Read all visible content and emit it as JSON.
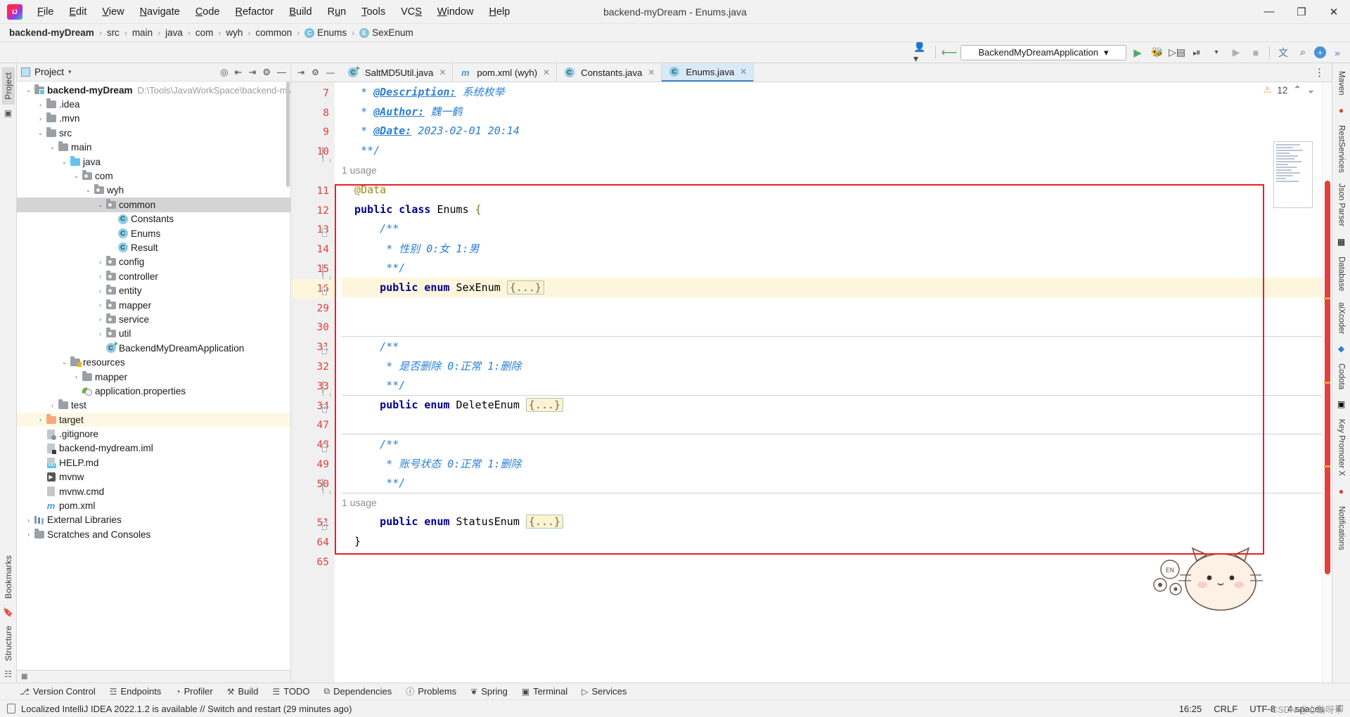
{
  "window": {
    "title": "backend-myDream - Enums.java",
    "minimize": "—",
    "maximize": "❐",
    "close": "✕"
  },
  "menu": {
    "items": [
      "File",
      "Edit",
      "View",
      "Navigate",
      "Code",
      "Refactor",
      "Build",
      "Run",
      "Tools",
      "VCS",
      "Window",
      "Help"
    ]
  },
  "breadcrumb": {
    "items": [
      {
        "label": "backend-myDream",
        "icon": "",
        "bold": true
      },
      {
        "label": "src",
        "icon": ""
      },
      {
        "label": "main",
        "icon": ""
      },
      {
        "label": "java",
        "icon": ""
      },
      {
        "label": "com",
        "icon": ""
      },
      {
        "label": "wyh",
        "icon": ""
      },
      {
        "label": "common",
        "icon": ""
      },
      {
        "label": "Enums",
        "icon": "C"
      },
      {
        "label": "SexEnum",
        "icon": "E"
      }
    ],
    "separator": "›"
  },
  "toolbar": {
    "profile_icon": "profile-icon",
    "hammer_icon": "build-hammer-icon",
    "run_config": "BackendMyDreamApplication",
    "run_config_caret": "▾",
    "run_icon": "▶",
    "debug_icon": "debug-icon",
    "run_coverage_icon": "coverage-icon",
    "profile_run_icon": "profiler-icon",
    "more_icon": "▾",
    "rerun_icon": "▶",
    "stop_icon": "■",
    "translate_icon": "translate-icon",
    "search_icon": "⌕",
    "updates_icon": "+",
    "expand_icon": "»"
  },
  "left_strip": {
    "tabs": [
      "Project",
      "Bookmarks",
      "Structure"
    ]
  },
  "project_panel": {
    "title": "Project",
    "caret": "▾",
    "actions": [
      "locate-icon",
      "expand-all-icon",
      "collapse-all-icon",
      "settings-icon",
      "hide-icon"
    ],
    "tree": [
      {
        "indent": 0,
        "arrow": "down",
        "icon": "module",
        "label": "backend-myDream",
        "bold": true,
        "path": "D:\\Tools\\JavaWorkSpace\\backend-my"
      },
      {
        "indent": 1,
        "arrow": "right",
        "icon": "folder",
        "label": ".idea"
      },
      {
        "indent": 1,
        "arrow": "right",
        "icon": "folder",
        "label": ".mvn"
      },
      {
        "indent": 1,
        "arrow": "down",
        "icon": "folder",
        "label": "src"
      },
      {
        "indent": 2,
        "arrow": "down",
        "icon": "folder",
        "label": "main"
      },
      {
        "indent": 3,
        "arrow": "down",
        "icon": "src-root",
        "label": "java"
      },
      {
        "indent": 4,
        "arrow": "down",
        "icon": "package",
        "label": "com"
      },
      {
        "indent": 5,
        "arrow": "down",
        "icon": "package",
        "label": "wyh"
      },
      {
        "indent": 6,
        "arrow": "down",
        "icon": "package",
        "label": "common",
        "selected": true
      },
      {
        "indent": 7,
        "arrow": "none",
        "icon": "class",
        "label": "Constants"
      },
      {
        "indent": 7,
        "arrow": "none",
        "icon": "class",
        "label": "Enums"
      },
      {
        "indent": 7,
        "arrow": "none",
        "icon": "class",
        "label": "Result"
      },
      {
        "indent": 6,
        "arrow": "right",
        "icon": "package",
        "label": "config"
      },
      {
        "indent": 6,
        "arrow": "right",
        "icon": "package",
        "label": "controller"
      },
      {
        "indent": 6,
        "arrow": "right",
        "icon": "package",
        "label": "entity"
      },
      {
        "indent": 6,
        "arrow": "right",
        "icon": "package",
        "label": "mapper"
      },
      {
        "indent": 6,
        "arrow": "right",
        "icon": "package",
        "label": "service"
      },
      {
        "indent": 6,
        "arrow": "right",
        "icon": "package",
        "label": "util"
      },
      {
        "indent": 6,
        "arrow": "none",
        "icon": "runclass",
        "label": "BackendMyDreamApplication"
      },
      {
        "indent": 3,
        "arrow": "down",
        "icon": "resources",
        "label": "resources"
      },
      {
        "indent": 4,
        "arrow": "right",
        "icon": "folder",
        "label": "mapper"
      },
      {
        "indent": 4,
        "arrow": "none",
        "icon": "spring",
        "label": "application.properties"
      },
      {
        "indent": 2,
        "arrow": "right",
        "icon": "folder",
        "label": "test"
      },
      {
        "indent": 1,
        "arrow": "right",
        "icon": "target",
        "label": "target",
        "highlight": true
      },
      {
        "indent": 1,
        "arrow": "none",
        "icon": "gitignore",
        "label": ".gitignore"
      },
      {
        "indent": 1,
        "arrow": "none",
        "icon": "iml",
        "label": "backend-mydream.iml"
      },
      {
        "indent": 1,
        "arrow": "none",
        "icon": "md",
        "label": "HELP.md"
      },
      {
        "indent": 1,
        "arrow": "none",
        "icon": "mvnw",
        "label": "mvnw"
      },
      {
        "indent": 1,
        "arrow": "none",
        "icon": "cmd",
        "label": "mvnw.cmd"
      },
      {
        "indent": 1,
        "arrow": "none",
        "icon": "maven",
        "label": "pom.xml"
      },
      {
        "indent": 0,
        "arrow": "right",
        "icon": "library",
        "label": "External Libraries"
      },
      {
        "indent": 0,
        "arrow": "right",
        "icon": "scratch",
        "label": "Scratches and Consoles"
      }
    ]
  },
  "editor": {
    "tabs": [
      {
        "label": "SaltMD5Util.java",
        "icon": "runclass",
        "active": false
      },
      {
        "label": "pom.xml (wyh)",
        "icon": "maven",
        "active": false
      },
      {
        "label": "Constants.java",
        "icon": "class",
        "active": false
      },
      {
        "label": "Enums.java",
        "icon": "class",
        "active": true
      }
    ],
    "tab_close": "✕",
    "tabs_more": "⋮",
    "inspection": {
      "warning_count": "12",
      "warning_icon": "⚠",
      "up": "⌃",
      "down": "⌄"
    },
    "lines": [
      {
        "num": "7",
        "fold": "",
        "type": "code",
        "segments": [
          {
            "t": "   * ",
            "c": "cmt"
          },
          {
            "t": "@Description:",
            "c": "cmt-b"
          },
          {
            "t": " 系统枚举",
            "c": "cmt"
          }
        ]
      },
      {
        "num": "8",
        "fold": "",
        "type": "code",
        "segments": [
          {
            "t": "   * ",
            "c": "cmt"
          },
          {
            "t": "@Author:",
            "c": "cmt-b"
          },
          {
            "t": " 魏一鹤",
            "c": "cmt"
          }
        ]
      },
      {
        "num": "9",
        "fold": "",
        "type": "code",
        "segments": [
          {
            "t": "   * ",
            "c": "cmt"
          },
          {
            "t": "@Date:",
            "c": "cmt-b"
          },
          {
            "t": " 2023-02-01 20:14",
            "c": "cmt"
          }
        ]
      },
      {
        "num": "10",
        "fold": "end",
        "type": "code",
        "segments": [
          {
            "t": "   **/",
            "c": "cmt"
          }
        ]
      },
      {
        "num": "",
        "fold": "",
        "type": "usage",
        "segments": [
          {
            "t": "1 usage",
            "c": "usage"
          }
        ]
      },
      {
        "num": "11",
        "fold": "",
        "type": "code",
        "segments": [
          {
            "t": "  @Data",
            "c": "ann"
          }
        ]
      },
      {
        "num": "12",
        "fold": "",
        "type": "code",
        "segments": [
          {
            "t": "  public class",
            "c": "kw"
          },
          {
            "t": " Enums ",
            "c": "plain"
          },
          {
            "t": "{",
            "c": "brace"
          }
        ]
      },
      {
        "num": "13",
        "fold": "start",
        "type": "code",
        "segments": [
          {
            "t": "      /**",
            "c": "cmt"
          }
        ]
      },
      {
        "num": "14",
        "fold": "",
        "type": "code",
        "segments": [
          {
            "t": "       * 性别 0:女 1:男",
            "c": "cmt"
          }
        ]
      },
      {
        "num": "15",
        "fold": "end",
        "type": "code",
        "segments": [
          {
            "t": "       **/",
            "c": "cmt"
          }
        ]
      },
      {
        "num": "16",
        "fold": "plus",
        "type": "code",
        "current": true,
        "segments": [
          {
            "t": "      public enum",
            "c": "kw"
          },
          {
            "t": " SexEnum ",
            "c": "plain"
          },
          {
            "t": "{...}",
            "c": "pill"
          }
        ]
      },
      {
        "num": "29",
        "fold": "",
        "type": "code",
        "segments": []
      },
      {
        "num": "30",
        "fold": "",
        "type": "code",
        "segments": []
      },
      {
        "num": "31",
        "fold": "start",
        "type": "code",
        "sep": true,
        "segments": [
          {
            "t": "      /**",
            "c": "cmt"
          }
        ]
      },
      {
        "num": "32",
        "fold": "",
        "type": "code",
        "segments": [
          {
            "t": "       * 是否删除 0:正常 1:删除",
            "c": "cmt"
          }
        ]
      },
      {
        "num": "33",
        "fold": "end",
        "type": "code",
        "segments": [
          {
            "t": "       **/",
            "c": "cmt"
          }
        ]
      },
      {
        "num": "34",
        "fold": "plus",
        "type": "code",
        "sep": true,
        "segments": [
          {
            "t": "      public enum",
            "c": "kw"
          },
          {
            "t": " DeleteEnum ",
            "c": "plain"
          },
          {
            "t": "{...}",
            "c": "pill"
          }
        ]
      },
      {
        "num": "47",
        "fold": "",
        "type": "code",
        "segments": []
      },
      {
        "num": "48",
        "fold": "start",
        "type": "code",
        "sep": true,
        "override": "override-icon",
        "segments": [
          {
            "t": "      /**",
            "c": "cmt"
          }
        ]
      },
      {
        "num": "49",
        "fold": "",
        "type": "code",
        "segments": [
          {
            "t": "       * 账号状态 0:正常 1:删除",
            "c": "cmt"
          }
        ]
      },
      {
        "num": "50",
        "fold": "end",
        "type": "code",
        "segments": [
          {
            "t": "       **/",
            "c": "cmt"
          }
        ]
      },
      {
        "num": "",
        "fold": "",
        "type": "usage",
        "sep": true,
        "segments": [
          {
            "t": "1 usage",
            "c": "usage"
          }
        ]
      },
      {
        "num": "51",
        "fold": "plus",
        "type": "code",
        "segments": [
          {
            "t": "      public enum",
            "c": "kw"
          },
          {
            "t": " StatusEnum ",
            "c": "plain"
          },
          {
            "t": "{...}",
            "c": "pill"
          }
        ]
      },
      {
        "num": "64",
        "fold": "",
        "type": "code",
        "segments": [
          {
            "t": "  }",
            "c": "plain"
          }
        ]
      },
      {
        "num": "65",
        "fold": "",
        "type": "code",
        "segments": []
      }
    ]
  },
  "right_strip": {
    "tabs": [
      "Maven",
      "RestServices",
      "Json Parser",
      "Database",
      "aiXcoder",
      "Codota",
      "Key Promoter X",
      "Notifications"
    ]
  },
  "bottom_tools": {
    "items": [
      {
        "label": "Version Control",
        "icon": "⎇"
      },
      {
        "label": "Endpoints",
        "icon": "☲"
      },
      {
        "label": "Profiler",
        "icon": "◔"
      },
      {
        "label": "Build",
        "icon": "⚒"
      },
      {
        "label": "TODO",
        "icon": "☰"
      },
      {
        "label": "Dependencies",
        "icon": "⧉"
      },
      {
        "label": "Problems",
        "icon": "ⓘ"
      },
      {
        "label": "Spring",
        "icon": "❦"
      },
      {
        "label": "Terminal",
        "icon": "▣"
      },
      {
        "label": "Services",
        "icon": "▷"
      }
    ]
  },
  "status_bar": {
    "message": "Localized IntelliJ IDEA 2022.1.2 is available // Switch and restart (29 minutes ago)",
    "time": "16:25",
    "line_separator": "CRLF",
    "encoding": "UTF-8",
    "indent": "4 spaces",
    "lock_icon": "⚿",
    "watermark": "CSDN @心動呀☀"
  }
}
